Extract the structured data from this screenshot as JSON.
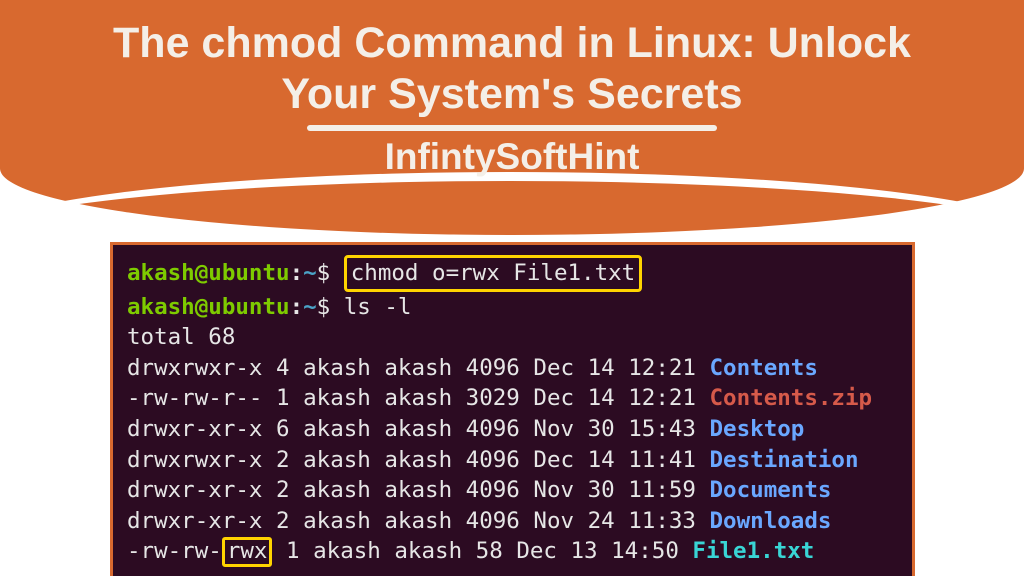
{
  "title_line1": "The chmod Command in Linux: Unlock",
  "title_line2": "Your System's Secrets",
  "subtitle": "InfintySoftHint",
  "prompt": {
    "user": "akash",
    "at": "@",
    "host": "ubuntu",
    "colon": ":",
    "path": "~",
    "dollar": "$"
  },
  "cmd1": "chmod o=rwx File1.txt",
  "cmd2": "ls -l",
  "total_line": "total 68",
  "rows": [
    {
      "perm": "drwxrwxr-x",
      "links": "4",
      "owner": "akash",
      "group": "akash",
      "size": "4096",
      "date": "Dec 14 12:21",
      "name": "Contents",
      "cls": "dir-blue"
    },
    {
      "perm": "-rw-rw-r--",
      "links": "1",
      "owner": "akash",
      "group": "akash",
      "size": "3029",
      "date": "Dec 14 12:21",
      "name": "Contents.zip",
      "cls": "file-red"
    },
    {
      "perm": "drwxr-xr-x",
      "links": "6",
      "owner": "akash",
      "group": "akash",
      "size": "4096",
      "date": "Nov 30 15:43",
      "name": "Desktop",
      "cls": "dir-blue"
    },
    {
      "perm": "drwxrwxr-x",
      "links": "2",
      "owner": "akash",
      "group": "akash",
      "size": "4096",
      "date": "Dec 14 11:41",
      "name": "Destination",
      "cls": "dir-blue"
    },
    {
      "perm": "drwxr-xr-x",
      "links": "2",
      "owner": "akash",
      "group": "akash",
      "size": "4096",
      "date": "Nov 30 11:59",
      "name": "Documents",
      "cls": "dir-blue"
    },
    {
      "perm": "drwxr-xr-x",
      "links": "2",
      "owner": "akash",
      "group": "akash",
      "size": "4096",
      "date": "Nov 24 11:33",
      "name": "Downloads",
      "cls": "dir-blue"
    }
  ],
  "last_row": {
    "perm_pre": "-rw-rw-",
    "perm_hl": "rwx",
    "links": "1",
    "owner": "akash",
    "group": "akash",
    "size": "  58",
    "date": "Dec 13 14:50",
    "name": "File1.txt",
    "cls": "file-cyan"
  }
}
